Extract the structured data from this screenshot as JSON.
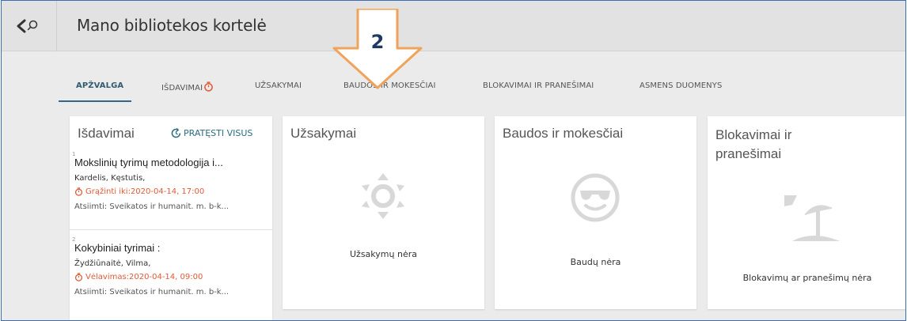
{
  "header": {
    "title": "Mano bibliotekos kortelė"
  },
  "annotation": {
    "number": "2"
  },
  "tabs": [
    {
      "label": "APŽVALGA"
    },
    {
      "label": "IŠDAVIMAI"
    },
    {
      "label": "UŽSAKYMAI"
    },
    {
      "label": "BAUDOS IR MOKESČIAI"
    },
    {
      "label": "BLOKAVIMAI IR PRANEŠIMAI"
    },
    {
      "label": "ASMENS DUOMENYS"
    }
  ],
  "loans_card": {
    "title": "Išdavimai",
    "renew_all": "PRATĘSTI VISUS",
    "items": [
      {
        "num": "1",
        "title": "Mokslinių tyrimų metodologija i...",
        "author": "Kardelis, Kęstutis,",
        "due": "Grąžinti iki:2020-04-14, 17:00",
        "return_info": "Atsiimti: Sveikatos ir humanit. m. b-k..."
      },
      {
        "num": "2",
        "title": "Kokybiniai tyrimai :",
        "author": "Žydžiūnaitė, Vilma,",
        "due": "Vėlavimas:2020-04-14, 09:00",
        "return_info": "Atsiimti: Sveikatos ir humanit. m. b-k..."
      }
    ]
  },
  "requests_card": {
    "title": "Užsakymai",
    "empty": "Užsakymų nėra"
  },
  "fines_card": {
    "title": "Baudos ir mokesčiai",
    "empty": "Baudų nėra"
  },
  "blocks_card": {
    "title": "Blokavimai ir pranešimai",
    "empty": "Blokavimų ar pranešimų nėra"
  },
  "colors": {
    "accent": "#2a6d80",
    "overdue": "#e15a36",
    "arrow": "#f0a35a",
    "frame": "#3c6db4"
  }
}
